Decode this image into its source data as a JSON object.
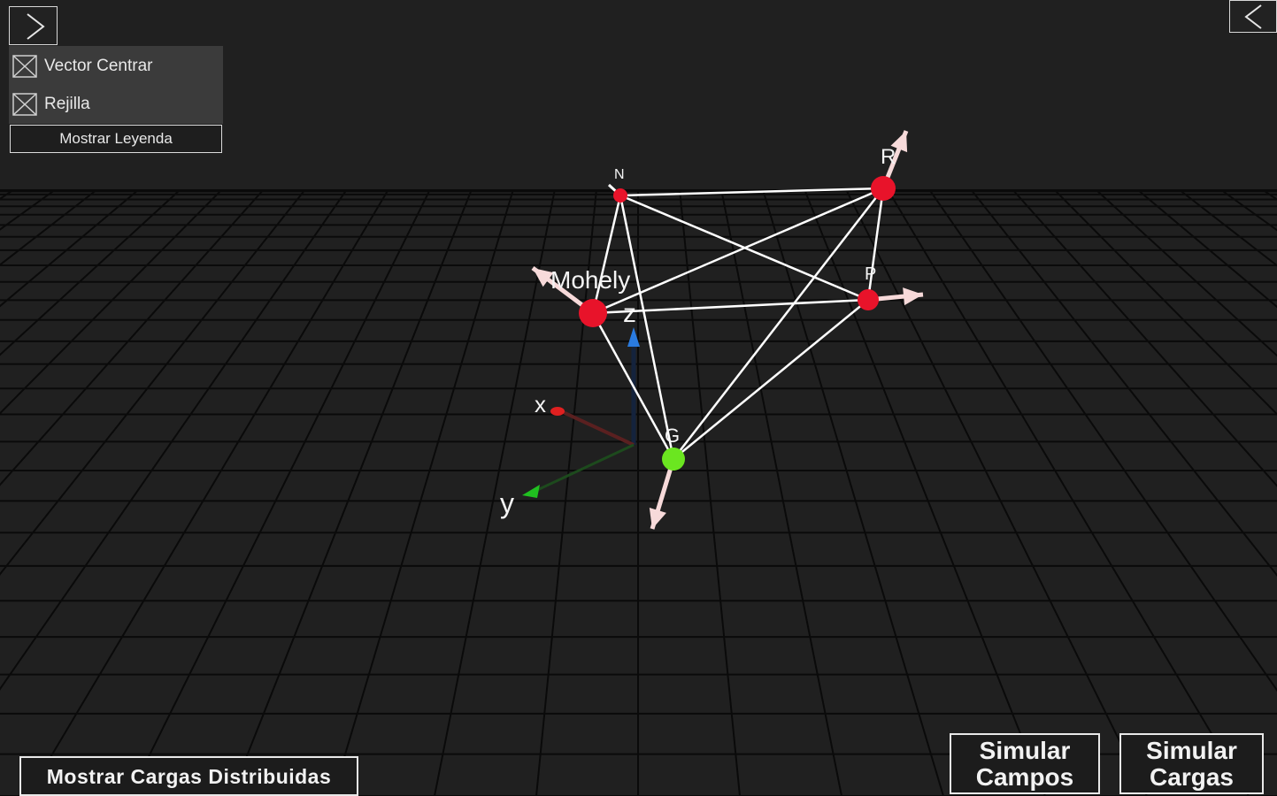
{
  "toolbar": {
    "expand_icon": "chevron-right-icon",
    "collapse_icon": "chevron-left-icon"
  },
  "options": {
    "vector_centrar": "Vector Centrar",
    "rejilla": "Rejilla",
    "mostrar_leyenda": "Mostrar Leyenda"
  },
  "scene": {
    "nodes": [
      {
        "id": "N",
        "label": "N",
        "color": "#e8132a"
      },
      {
        "id": "R",
        "label": "R",
        "color": "#e8132a"
      },
      {
        "id": "M",
        "label": "Mohely",
        "color": "#e8132a"
      },
      {
        "id": "P",
        "label": "P",
        "color": "#e8132a"
      },
      {
        "id": "G",
        "label": "G",
        "color": "#6be620"
      }
    ],
    "axes": {
      "x": "x",
      "y": "y",
      "z": "z"
    },
    "colors": {
      "x_axis": "#e02020",
      "y_axis": "#20c020",
      "z_axis": "#2a7be0",
      "bars": "#ffffff",
      "loads": "#f7dada"
    }
  },
  "actions": {
    "mostrar_cargas_distribuidas": "Mostrar Cargas Distribuidas",
    "simular_campos_1": "Simular",
    "simular_campos_2": "Campos",
    "simular_cargas_1": "Simular",
    "simular_cargas_2": "Cargas"
  }
}
